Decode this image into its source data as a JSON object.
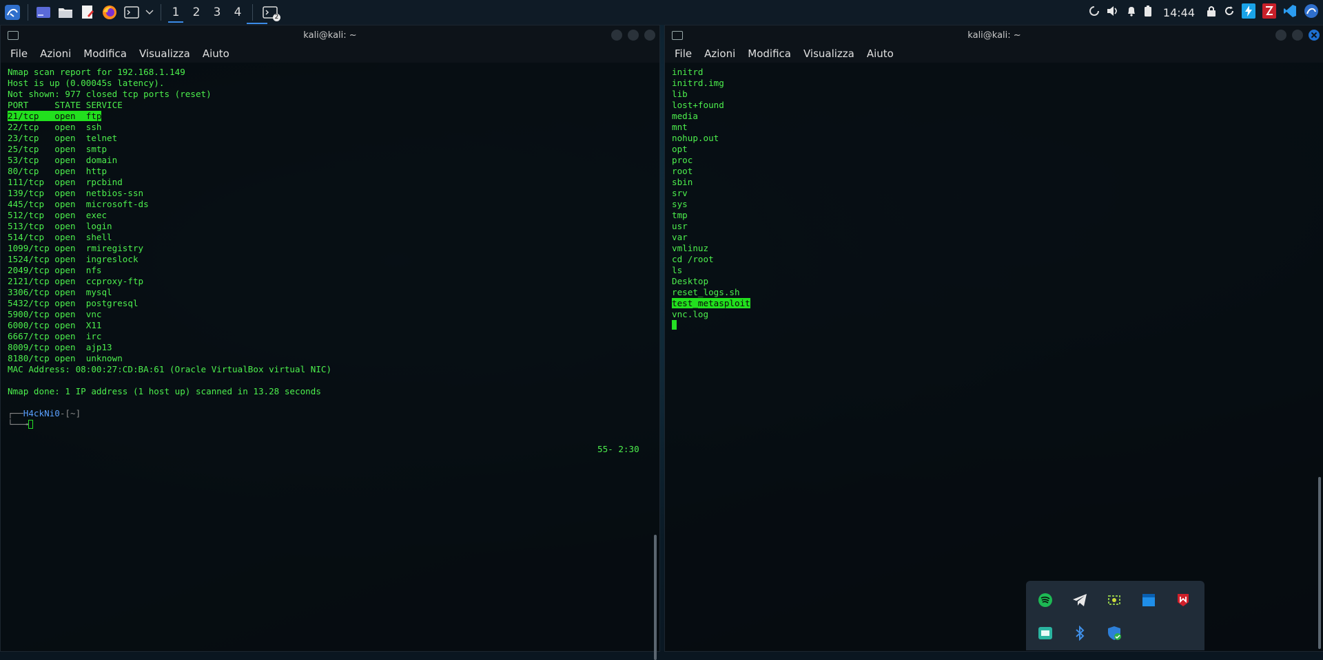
{
  "taskbar": {
    "workspaces": [
      "1",
      "2",
      "3",
      "4"
    ],
    "active_workspace": "1",
    "terminal_badge": "2",
    "clock": "14:44",
    "accent_color": "#3b8be8",
    "tray_icons": [
      "spinner-icon",
      "volume-icon",
      "bell-icon",
      "battery-icon",
      "lock-icon",
      "refresh-icon",
      "bolt-app-icon",
      "filezilla-icon",
      "vscode-icon",
      "kali-icon"
    ]
  },
  "left_terminal": {
    "title": "kali@kali: ~",
    "menu": [
      "File",
      "Azioni",
      "Modifica",
      "Visualizza",
      "Aiuto"
    ],
    "header_lines": [
      "Nmap scan report for 192.168.1.149",
      "Host is up (0.00045s latency).",
      "Not shown: 977 closed tcp ports (reset)",
      "PORT     STATE SERVICE"
    ],
    "ports": [
      "21/tcp   open  ftp",
      "22/tcp   open  ssh",
      "23/tcp   open  telnet",
      "25/tcp   open  smtp",
      "53/tcp   open  domain",
      "80/tcp   open  http",
      "111/tcp  open  rpcbind",
      "139/tcp  open  netbios-ssn",
      "445/tcp  open  microsoft-ds",
      "512/tcp  open  exec",
      "513/tcp  open  login",
      "514/tcp  open  shell",
      "1099/tcp open  rmiregistry",
      "1524/tcp open  ingreslock",
      "2049/tcp open  nfs",
      "2121/tcp open  ccproxy-ftp",
      "3306/tcp open  mysql",
      "5432/tcp open  postgresql",
      "5900/tcp open  vnc",
      "6000/tcp open  X11",
      "6667/tcp open  irc",
      "8009/tcp open  ajp13",
      "8180/tcp open  unknown"
    ],
    "mac_line": "MAC Address: 08:00:27:CD:BA:61 (Oracle VirtualBox virtual NIC)",
    "done_line": "Nmap done: 1 IP address (1 host up) scanned in 13.28 seconds",
    "prompt_user": "H4ckNi0",
    "prompt_dir": "-[~]",
    "prompt_top": "┌──",
    "prompt_bottom": "└──╼",
    "status_right": "55- 2:30"
  },
  "right_terminal": {
    "title": "kali@kali: ~",
    "menu": [
      "File",
      "Azioni",
      "Modifica",
      "Visualizza",
      "Aiuto"
    ],
    "lines": [
      "initrd",
      "initrd.img",
      "lib",
      "lost+found",
      "media",
      "mnt",
      "nohup.out",
      "opt",
      "proc",
      "root",
      "sbin",
      "srv",
      "sys",
      "tmp",
      "usr",
      "var",
      "vmlinuz",
      "cd /root",
      "ls",
      "Desktop",
      "reset_logs.sh",
      "test_metasploit",
      "vnc.log"
    ],
    "highlighted_line": "test_metasploit"
  },
  "tray_popup": {
    "icons": [
      "spotify-icon",
      "telegram-icon",
      "screenshot-tool-icon",
      "window-app-icon",
      "mcafee-icon",
      "remote-app-icon",
      "bluetooth-icon",
      "security-shield-icon"
    ]
  }
}
